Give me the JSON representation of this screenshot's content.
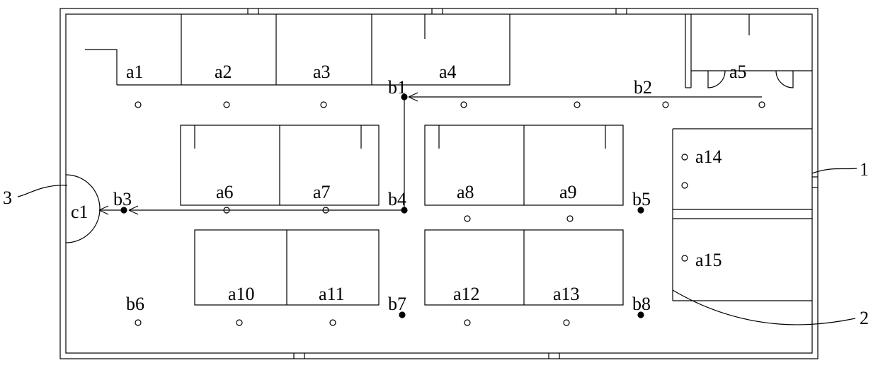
{
  "labels": {
    "a1": "a1",
    "a2": "a2",
    "a3": "a3",
    "a4": "a4",
    "a5": "a5",
    "a6": "a6",
    "a7": "a7",
    "a8": "a8",
    "a9": "a9",
    "a10": "a10",
    "a11": "a11",
    "a12": "a12",
    "a13": "a13",
    "a14": "a14",
    "a15": "a15",
    "b1": "b1",
    "b2": "b2",
    "b3": "b3",
    "b4": "b4",
    "b5": "b5",
    "b6": "b6",
    "b7": "b7",
    "b8": "b8",
    "c1": "c1",
    "ref1": "1",
    "ref2": "2",
    "ref3": "3"
  }
}
